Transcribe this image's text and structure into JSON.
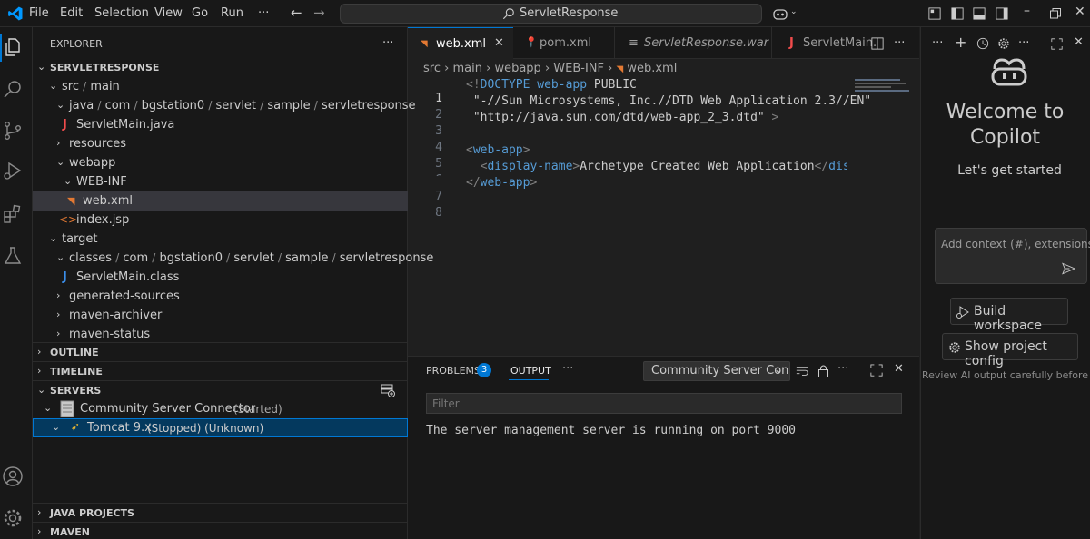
{
  "menu": [
    "File",
    "Edit",
    "Selection",
    "View",
    "Go",
    "Run",
    "···"
  ],
  "title_search": "ServletResponse",
  "explorer": {
    "header": "EXPLORER",
    "more": "···",
    "root": "SERVLETRESPONSE",
    "tree": {
      "src": "src",
      "main": "main",
      "java": "java",
      "com": "com",
      "bg": "bgstation0",
      "servlet": "servlet",
      "sample": "sample",
      "servletresponse": "servletresponse",
      "servletmain_java": "ServletMain.java",
      "resources": "resources",
      "webapp": "webapp",
      "webinf": "WEB-INF",
      "webxml": "web.xml",
      "indexjsp": "index.jsp",
      "target": "target",
      "classes": "classes",
      "servletmain_class": "ServletMain.class",
      "generated_sources": "generated-sources",
      "maven_archiver": "maven-archiver",
      "maven_status": "maven-status"
    },
    "outline": "OUTLINE",
    "timeline": "TIMELINE",
    "servers": "SERVERS",
    "server_name": "Community Server Connector",
    "server_status": "(Started)",
    "tomcat_name": "Tomcat 9.x",
    "tomcat_status": "(Stopped) (Unknown)",
    "java_projects": "JAVA PROJECTS",
    "maven": "MAVEN"
  },
  "tabs": {
    "t1": "web.xml",
    "t2": "pom.xml",
    "t3": "ServletResponse.war",
    "t4": "ServletMain.",
    "more": "···"
  },
  "breadcrumb": {
    "b1": "src",
    "b2": "main",
    "b3": "webapp",
    "b4": "WEB-INF",
    "b5": "web.xml"
  },
  "code": {
    "line_numbers": [
      "1",
      "2",
      "3",
      "4",
      "5",
      "6",
      "7",
      "8"
    ],
    "l1a": "<!",
    "l1b": "DOCTYPE",
    "l1c": " web-app",
    "l1d": " PUBLIC",
    "l2": " \"-//Sun Microsystems, Inc.//DTD Web Application 2.3//EN\"",
    "l3a": " \"",
    "l3b": "http://java.sun.com/dtd/web-app_2_3.dtd",
    "l3c": "\"",
    "l3d": " >",
    "l5a": "<",
    "l5b": "web-app",
    "l5c": ">",
    "l6a": "  <",
    "l6b": "display-name",
    "l6c": ">",
    "l6d": "Archetype Created Web Application",
    "l6e": "</",
    "l6f": "display-name",
    "l7a": "</",
    "l7b": "web-app",
    "l7c": ">"
  },
  "panel": {
    "problems": "PROBLEMS",
    "problems_count": "3",
    "output": "OUTPUT",
    "more": "···",
    "source": "Community Server Con",
    "filter_placeholder": "Filter",
    "output_text": "The server management server is running on port 9000"
  },
  "copilot": {
    "welcome1": "Welcome to",
    "welcome2": "Copilot",
    "subtitle": "Let's get started",
    "ctx_placeholder": "Add context (#), extensions",
    "build": "Build workspace",
    "show_config": "Show project config",
    "disclaimer": "Review AI output carefully before use"
  },
  "colors": {
    "accent": "#0078d4",
    "xml_icon": "#e37933",
    "java_icon": "#f14c4c",
    "class_icon": "#3b8eea",
    "badge": "#0078d4"
  }
}
